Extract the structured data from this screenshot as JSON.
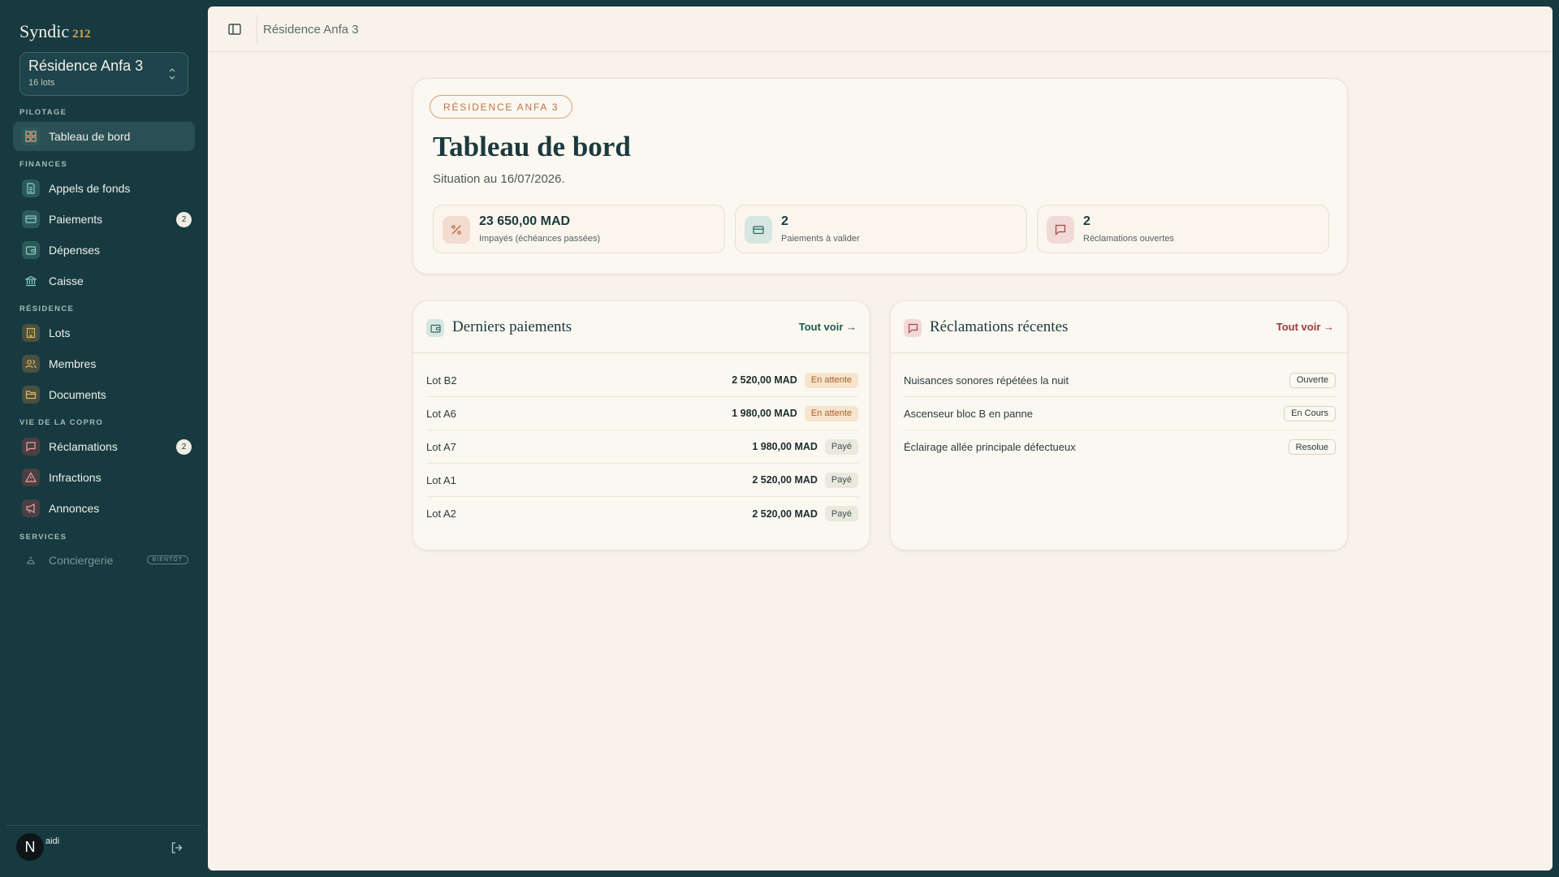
{
  "brand": {
    "name": "Syndic",
    "number": "212"
  },
  "residence_switcher": {
    "name": "Résidence Anfa 3",
    "lots": "16 lots"
  },
  "sidebar": {
    "sections": {
      "pilotage": "PILOTAGE",
      "finances": "FINANCES",
      "residence": "RÉSIDENCE",
      "vie": "VIE DE LA COPRO",
      "services": "SERVICES"
    },
    "items": {
      "dashboard": "Tableau de bord",
      "appels": "Appels de fonds",
      "paiements": "Paiements",
      "paiements_count": "2",
      "depenses": "Dépenses",
      "caisse": "Caisse",
      "lots": "Lots",
      "membres": "Membres",
      "documents": "Documents",
      "reclamations": "Réclamations",
      "reclamations_count": "2",
      "infractions": "Infractions",
      "annonces": "Annonces",
      "conciergerie": "Conciergerie",
      "soon": "BIENTÔT"
    },
    "user": {
      "initial": "N",
      "name": "aidi"
    }
  },
  "topbar": {
    "breadcrumb": "Résidence Anfa 3"
  },
  "hero": {
    "pill": "RÉSIDENCE ANFA 3",
    "title": "Tableau de bord",
    "subtitle": "Situation au 16/07/2026.",
    "kpis": [
      {
        "value": "23 650,00 MAD",
        "label": "Impayés (échéances passées)",
        "icon": "percent-icon"
      },
      {
        "value": "2",
        "label": "Paiements à valider",
        "icon": "credit-card-icon"
      },
      {
        "value": "2",
        "label": "Réclamations ouvertes",
        "icon": "message-icon"
      }
    ]
  },
  "payments": {
    "title": "Derniers paiements",
    "see_all": "Tout voir",
    "rows": [
      {
        "lot": "Lot B2",
        "amount": "2 520,00 MAD",
        "status": "En attente"
      },
      {
        "lot": "Lot A6",
        "amount": "1 980,00 MAD",
        "status": "En attente"
      },
      {
        "lot": "Lot A7",
        "amount": "1 980,00 MAD",
        "status": "Payé"
      },
      {
        "lot": "Lot A1",
        "amount": "2 520,00 MAD",
        "status": "Payé"
      },
      {
        "lot": "Lot A2",
        "amount": "2 520,00 MAD",
        "status": "Payé"
      }
    ]
  },
  "complaints": {
    "title": "Réclamations récentes",
    "see_all": "Tout voir",
    "rows": [
      {
        "text": "Nuisances sonores répétées la nuit",
        "status": "Ouverte"
      },
      {
        "text": "Ascenseur bloc B en panne",
        "status": "En Cours"
      },
      {
        "text": "Éclairage allée principale défectueux",
        "status": "Resolue"
      }
    ]
  },
  "colors": {
    "sidebar_bg": "#163a40",
    "content_bg": "#f7f3ea",
    "accent_orange": "#c0724a",
    "link_green": "#1f5a4a",
    "link_red": "#9b3b3b",
    "pending_badge": "#f6e4cc"
  }
}
